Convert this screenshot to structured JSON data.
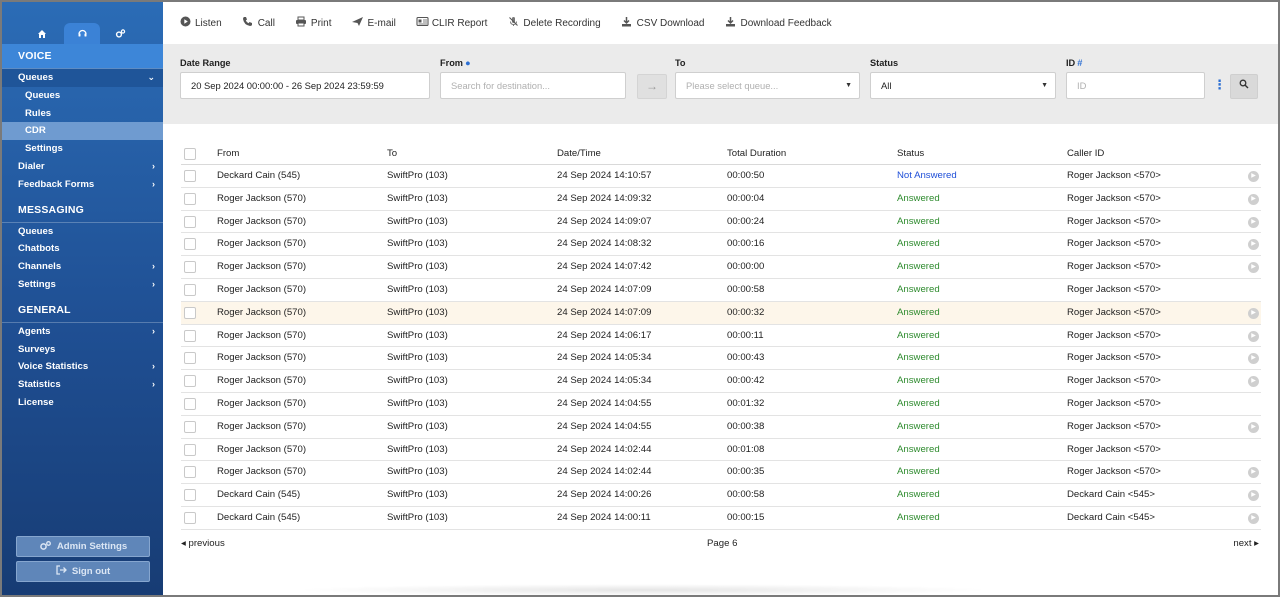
{
  "sidebar": {
    "tabs": [
      {
        "icon": "home-icon"
      },
      {
        "icon": "headset-icon"
      },
      {
        "icon": "cogs-icon"
      }
    ],
    "voice_section": "VOICE",
    "queues": "Queues",
    "queues_sub": [
      "Queues",
      "Rules",
      "CDR",
      "Settings"
    ],
    "dialer": "Dialer",
    "feedback_forms": "Feedback Forms",
    "messaging_section": "MESSAGING",
    "messaging_items": [
      "Queues",
      "Chatbots",
      "Channels",
      "Settings"
    ],
    "general_section": "GENERAL",
    "general_items": [
      "Agents",
      "Surveys",
      "Voice Statistics",
      "Statistics",
      "License"
    ],
    "admin_settings": "Admin Settings",
    "sign_out": "Sign out"
  },
  "toolbar": {
    "listen": "Listen",
    "call": "Call",
    "print": "Print",
    "email": "E-mail",
    "clir_report": "CLIR Report",
    "delete_recording": "Delete Recording",
    "csv_download": "CSV Download",
    "download_feedback": "Download Feedback"
  },
  "filters": {
    "date_range_label": "Date Range",
    "date_range_value": "20 Sep 2024 00:00:00 - 26 Sep 2024 23:59:59",
    "from_label": "From",
    "from_placeholder": "Search for destination...",
    "to_label": "To",
    "to_placeholder": "Please select queue...",
    "status_label": "Status",
    "status_value": "All",
    "id_label": "ID",
    "id_placeholder": "ID"
  },
  "table": {
    "headers": [
      "From",
      "To",
      "Date/Time",
      "Total Duration",
      "Status",
      "Caller ID"
    ],
    "rows": [
      {
        "from": "Deckard Cain (545)",
        "to": "SwiftPro (103)",
        "dt": "24 Sep 2024 14:10:57",
        "dur": "00:00:50",
        "status": "Not Answered",
        "cid": "Roger Jackson <570>"
      },
      {
        "from": "Roger Jackson (570)",
        "to": "SwiftPro (103)",
        "dt": "24 Sep 2024 14:09:32",
        "dur": "00:00:04",
        "status": "Answered",
        "cid": "Roger Jackson <570>"
      },
      {
        "from": "Roger Jackson (570)",
        "to": "SwiftPro (103)",
        "dt": "24 Sep 2024 14:09:07",
        "dur": "00:00:24",
        "status": "Answered",
        "cid": "Roger Jackson <570>"
      },
      {
        "from": "Roger Jackson (570)",
        "to": "SwiftPro (103)",
        "dt": "24 Sep 2024 14:08:32",
        "dur": "00:00:16",
        "status": "Answered",
        "cid": "Roger Jackson <570>"
      },
      {
        "from": "Roger Jackson (570)",
        "to": "SwiftPro (103)",
        "dt": "24 Sep 2024 14:07:42",
        "dur": "00:00:00",
        "status": "Answered",
        "cid": "Roger Jackson <570>"
      },
      {
        "from": "Roger Jackson (570)",
        "to": "SwiftPro (103)",
        "dt": "24 Sep 2024 14:07:09",
        "dur": "00:00:58",
        "status": "Answered",
        "cid": "Roger Jackson <570>"
      },
      {
        "from": "Roger Jackson (570)",
        "to": "SwiftPro (103)",
        "dt": "24 Sep 2024 14:07:09",
        "dur": "00:00:32",
        "status": "Answered",
        "cid": "Roger Jackson <570>"
      },
      {
        "from": "Roger Jackson (570)",
        "to": "SwiftPro (103)",
        "dt": "24 Sep 2024 14:06:17",
        "dur": "00:00:11",
        "status": "Answered",
        "cid": "Roger Jackson <570>"
      },
      {
        "from": "Roger Jackson (570)",
        "to": "SwiftPro (103)",
        "dt": "24 Sep 2024 14:05:34",
        "dur": "00:00:43",
        "status": "Answered",
        "cid": "Roger Jackson <570>"
      },
      {
        "from": "Roger Jackson (570)",
        "to": "SwiftPro (103)",
        "dt": "24 Sep 2024 14:05:34",
        "dur": "00:00:42",
        "status": "Answered",
        "cid": "Roger Jackson <570>"
      },
      {
        "from": "Roger Jackson (570)",
        "to": "SwiftPro (103)",
        "dt": "24 Sep 2024 14:04:55",
        "dur": "00:01:32",
        "status": "Answered",
        "cid": "Roger Jackson <570>"
      },
      {
        "from": "Roger Jackson (570)",
        "to": "SwiftPro (103)",
        "dt": "24 Sep 2024 14:04:55",
        "dur": "00:00:38",
        "status": "Answered",
        "cid": "Roger Jackson <570>"
      },
      {
        "from": "Roger Jackson (570)",
        "to": "SwiftPro (103)",
        "dt": "24 Sep 2024 14:02:44",
        "dur": "00:01:08",
        "status": "Answered",
        "cid": "Roger Jackson <570>"
      },
      {
        "from": "Roger Jackson (570)",
        "to": "SwiftPro (103)",
        "dt": "24 Sep 2024 14:02:44",
        "dur": "00:00:35",
        "status": "Answered",
        "cid": "Roger Jackson <570>"
      },
      {
        "from": "Deckard Cain (545)",
        "to": "SwiftPro (103)",
        "dt": "24 Sep 2024 14:00:26",
        "dur": "00:00:58",
        "status": "Answered",
        "cid": "Deckard Cain <545>"
      },
      {
        "from": "Deckard Cain (545)",
        "to": "SwiftPro (103)",
        "dt": "24 Sep 2024 14:00:11",
        "dur": "00:00:15",
        "status": "Answered",
        "cid": "Deckard Cain <545>"
      }
    ]
  },
  "pager": {
    "previous": "previous",
    "page": "Page 6",
    "next": "next"
  },
  "colors": {
    "answered": "#2e8b2e",
    "not_answered": "#1f4fd8",
    "sidebar": "#1f4f93",
    "highlight_row": "#fdf6ea"
  }
}
